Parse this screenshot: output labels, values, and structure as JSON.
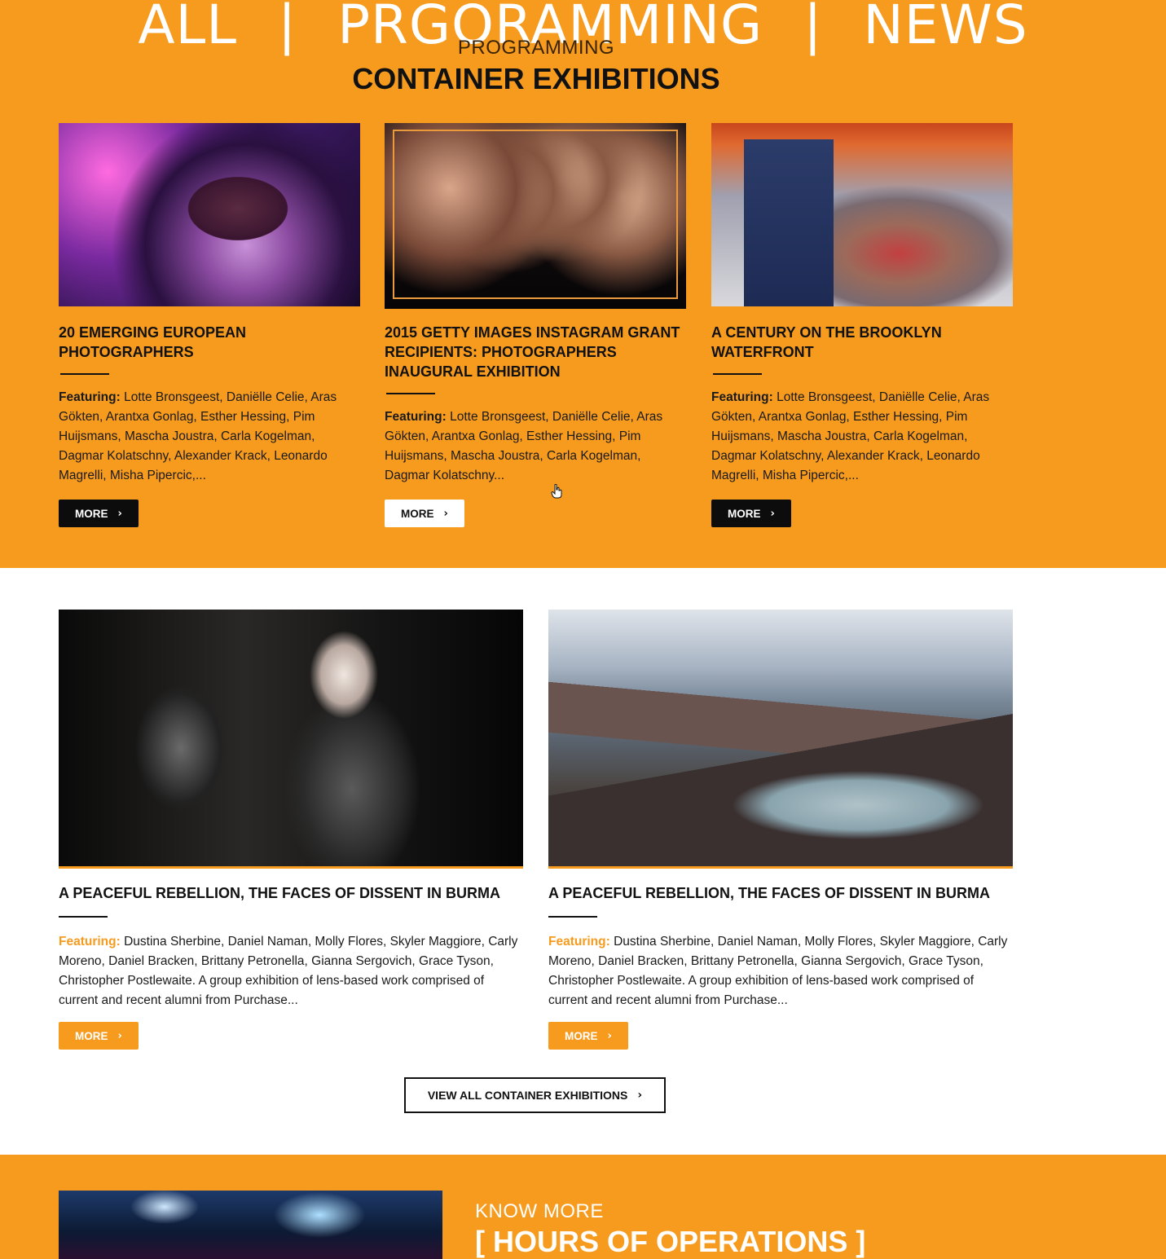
{
  "top_nav": {
    "items": [
      "ALL",
      "PRGORAMMING",
      "NEWS"
    ],
    "separator": "|"
  },
  "section": {
    "kicker": "PROGRAMMING",
    "title": "CONTAINER EXHIBITIONS"
  },
  "featured_cards": [
    {
      "title": "20 EMERGING EUROPEAN PHOTOGRAPHERS",
      "featuring_label": "Featuring:",
      "featuring_text": " Lotte Bronsgeest, Daniëlle Celie, Aras Gökten, Arantxa Gonlag, Esther Hessing, Pim Huijsmans, Mascha Joustra, Carla Kogelman, Dagmar Kolatschny, Alexander Krack, Leonardo Magrelli, Misha Pipercic,...",
      "button": "MORE"
    },
    {
      "title": "2015 GETTY IMAGES INSTAGRAM GRANT RECIPIENTS: PHOTOGRAPHERS INAUGURAL EXHIBITION",
      "featuring_label": "Featuring:",
      "featuring_text": " Lotte Bronsgeest, Daniëlle Celie, Aras Gökten, Arantxa Gonlag, Esther Hessing, Pim Huijsmans, Mascha Joustra, Carla Kogelman, Dagmar Kolatschny...",
      "button": "MORE"
    },
    {
      "title": "A CENTURY ON THE BROOKLYN WATERFRONT",
      "featuring_label": "Featuring:",
      "featuring_text": " Lotte Bronsgeest, Daniëlle Celie, Aras Gökten, Arantxa Gonlag, Esther Hessing, Pim Huijsmans, Mascha Joustra, Carla Kogelman, Dagmar Kolatschny, Alexander Krack, Leonardo Magrelli, Misha Pipercic,...",
      "button": "MORE"
    }
  ],
  "wide_cards": [
    {
      "title": "A PEACEFUL REBELLION, THE FACES OF DISSENT IN BURMA",
      "featuring_label": "Featuring:",
      "featuring_text": " Dustina Sherbine, Daniel Naman, Molly Flores, Skyler Maggiore, Carly Moreno, Daniel Bracken, Brittany Petronella, Gianna Sergovich, Grace Tyson, Christopher Postlewaite. A group exhibition of lens-based work comprised of current and recent alumni from Purchase...",
      "button": "MORE"
    },
    {
      "title": "A PEACEFUL REBELLION, THE FACES OF DISSENT IN BURMA",
      "featuring_label": "Featuring:",
      "featuring_text": " Dustina Sherbine, Daniel Naman, Molly Flores, Skyler Maggiore, Carly Moreno, Daniel Bracken, Brittany Petronella, Gianna Sergovich, Grace Tyson, Christopher Postlewaite. A group exhibition of lens-based work comprised of current and recent alumni from Purchase...",
      "button": "MORE"
    }
  ],
  "view_all": "VIEW ALL CONTAINER EXHIBITIONS",
  "bottom": {
    "kicker": "KNOW MORE",
    "title": "[ HOURS OF OPERATIONS ]"
  },
  "colors": {
    "accent": "#f79b1f",
    "dark": "#0c0c0c",
    "white": "#ffffff"
  },
  "icons": {
    "chevron": "chevron-right-icon",
    "cursor": "hand-pointer-icon"
  }
}
